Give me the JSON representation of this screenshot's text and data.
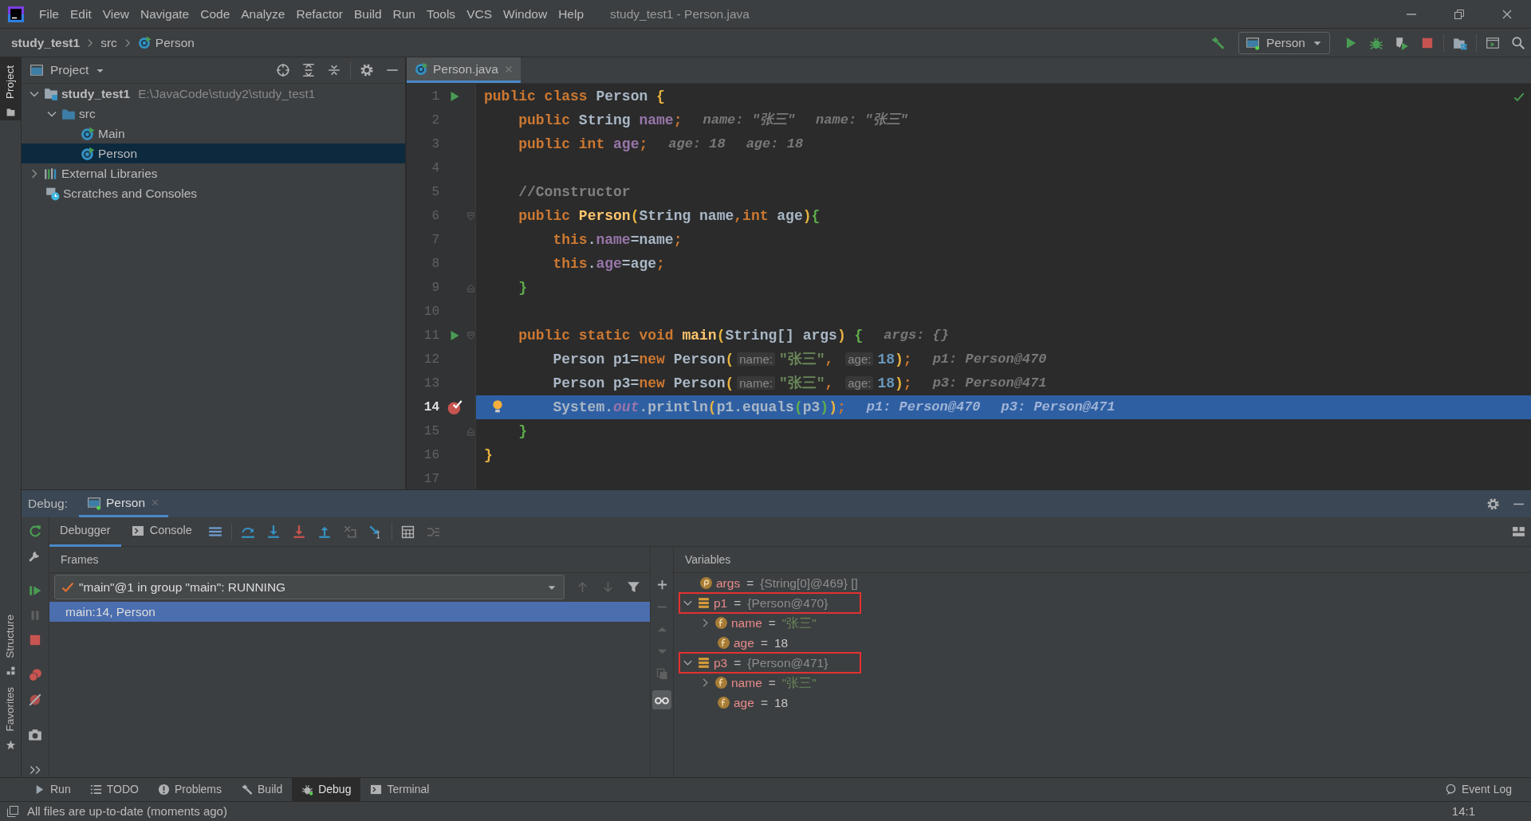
{
  "window": {
    "title": "study_test1 - Person.java"
  },
  "menu": [
    "File",
    "Edit",
    "View",
    "Navigate",
    "Code",
    "Analyze",
    "Refactor",
    "Build",
    "Run",
    "Tools",
    "VCS",
    "Window",
    "Help"
  ],
  "breadcrumbs": [
    {
      "label": "study_test1",
      "kind": "project"
    },
    {
      "label": "src",
      "kind": "folder"
    },
    {
      "label": "Person",
      "kind": "class"
    }
  ],
  "run_config": {
    "label": "Person"
  },
  "tool_stripe": [
    {
      "label": "Project",
      "kind": "project",
      "selected": true
    },
    {
      "label": "Structure",
      "kind": "structure",
      "selected": false
    },
    {
      "label": "Favorites",
      "kind": "favorites",
      "selected": false
    }
  ],
  "project": {
    "title": "Project",
    "tree": [
      {
        "label": "study_test1",
        "path": "E:\\JavaCode\\study2\\study_test1",
        "kind": "module",
        "expanded": true,
        "selected": false,
        "children": [
          {
            "label": "src",
            "kind": "folder",
            "expanded": true,
            "selected": false,
            "children": [
              {
                "label": "Main",
                "kind": "class",
                "selected": false
              },
              {
                "label": "Person",
                "kind": "class",
                "selected": true
              }
            ]
          }
        ]
      },
      {
        "label": "External Libraries",
        "kind": "libraries",
        "expanded": false,
        "selected": false
      },
      {
        "label": "Scratches and Consoles",
        "kind": "scratches",
        "selected": false
      }
    ]
  },
  "editor": {
    "tabs": [
      {
        "label": "Person.java",
        "selected": true
      }
    ],
    "lines": [
      {
        "number": "1",
        "run": true,
        "breakpoint": false,
        "fold_open": false,
        "fold_close": false,
        "bulb": false,
        "current": false,
        "tokens": [
          {
            "kind": "kw",
            "text": "public class "
          },
          {
            "kind": "txt",
            "text": "Person "
          },
          {
            "kind": "b1",
            "text": "{"
          }
        ]
      },
      {
        "number": "2",
        "run": false,
        "breakpoint": false,
        "fold_open": false,
        "fold_close": false,
        "bulb": false,
        "current": false,
        "tokens": [
          {
            "kind": "kw",
            "text": "    public "
          },
          {
            "kind": "txt",
            "text": "String "
          },
          {
            "kind": "fld",
            "text": "name"
          },
          {
            "kind": "kw",
            "text": ";"
          }
        ],
        "values": [
          "name: \"张三\"",
          "name: \"张三\""
        ]
      },
      {
        "number": "3",
        "run": false,
        "breakpoint": false,
        "fold_open": false,
        "fold_close": false,
        "bulb": false,
        "current": false,
        "tokens": [
          {
            "kind": "kw",
            "text": "    public int "
          },
          {
            "kind": "fld",
            "text": "age"
          },
          {
            "kind": "kw",
            "text": ";"
          }
        ],
        "values": [
          "age: 18",
          "age: 18"
        ]
      },
      {
        "number": "4",
        "run": false,
        "breakpoint": false,
        "fold_open": false,
        "fold_close": false,
        "bulb": false,
        "current": false
      },
      {
        "number": "5",
        "run": false,
        "breakpoint": false,
        "fold_open": false,
        "fold_close": false,
        "bulb": false,
        "current": false,
        "tokens": [
          {
            "kind": "cmt",
            "text": "    //Constructor"
          }
        ]
      },
      {
        "number": "6",
        "run": false,
        "breakpoint": false,
        "fold_open": true,
        "fold_close": false,
        "bulb": false,
        "current": false,
        "tokens": [
          {
            "kind": "kw",
            "text": "    public "
          },
          {
            "kind": "mth",
            "text": "Person"
          },
          {
            "kind": "b1",
            "text": "("
          },
          {
            "kind": "txt",
            "text": "String name"
          },
          {
            "kind": "kw",
            "text": ","
          },
          {
            "kind": "kw",
            "text": "int "
          },
          {
            "kind": "txt",
            "text": "age"
          },
          {
            "kind": "b1",
            "text": ")"
          },
          {
            "kind": "b2",
            "text": "{"
          }
        ]
      },
      {
        "number": "7",
        "run": false,
        "breakpoint": false,
        "fold_open": false,
        "fold_close": false,
        "bulb": false,
        "current": false,
        "tokens": [
          {
            "kind": "kw",
            "text": "        this"
          },
          {
            "kind": "txt",
            "text": "."
          },
          {
            "kind": "fld",
            "text": "name"
          },
          {
            "kind": "txt",
            "text": "=name"
          },
          {
            "kind": "kw",
            "text": ";"
          }
        ]
      },
      {
        "number": "8",
        "run": false,
        "breakpoint": false,
        "fold_open": false,
        "fold_close": false,
        "bulb": false,
        "current": false,
        "tokens": [
          {
            "kind": "kw",
            "text": "        this"
          },
          {
            "kind": "txt",
            "text": "."
          },
          {
            "kind": "fld",
            "text": "age"
          },
          {
            "kind": "txt",
            "text": "=age"
          },
          {
            "kind": "kw",
            "text": ";"
          }
        ]
      },
      {
        "number": "9",
        "run": false,
        "breakpoint": false,
        "fold_open": false,
        "fold_close": true,
        "bulb": false,
        "current": false,
        "tokens": [
          {
            "kind": "b2",
            "text": "    }"
          }
        ]
      },
      {
        "number": "10",
        "run": false,
        "breakpoint": false,
        "fold_open": false,
        "fold_close": false,
        "bulb": false,
        "current": false
      },
      {
        "number": "11",
        "run": true,
        "breakpoint": false,
        "fold_open": true,
        "fold_close": false,
        "bulb": false,
        "current": false,
        "tokens": [
          {
            "kind": "kw",
            "text": "    public static void "
          },
          {
            "kind": "mth",
            "text": "main"
          },
          {
            "kind": "b1",
            "text": "("
          },
          {
            "kind": "txt",
            "text": "String[] args"
          },
          {
            "kind": "b1",
            "text": ")"
          },
          {
            "kind": "b2",
            "text": " {"
          }
        ],
        "values": [
          "args: {}"
        ]
      },
      {
        "number": "12",
        "run": false,
        "breakpoint": false,
        "fold_open": false,
        "fold_close": false,
        "bulb": false,
        "current": false,
        "tokens": [
          {
            "kind": "txt",
            "text": "        Person p1="
          },
          {
            "kind": "kw",
            "text": "new "
          },
          {
            "kind": "txt",
            "text": "Person"
          },
          {
            "kind": "b1",
            "text": "("
          },
          {
            "kind": "hint",
            "text": "name:"
          },
          {
            "kind": "str",
            "text": "\"张三\""
          },
          {
            "kind": "kw",
            "text": ", "
          },
          {
            "kind": "hint",
            "text": "age:"
          },
          {
            "kind": "num",
            "text": "18"
          },
          {
            "kind": "b1",
            "text": ")"
          },
          {
            "kind": "kw",
            "text": ";"
          }
        ],
        "values": [
          "p1: Person@470"
        ]
      },
      {
        "number": "13",
        "run": false,
        "breakpoint": false,
        "fold_open": false,
        "fold_close": false,
        "bulb": false,
        "current": false,
        "tokens": [
          {
            "kind": "txt",
            "text": "        Person p3="
          },
          {
            "kind": "kw",
            "text": "new "
          },
          {
            "kind": "txt",
            "text": "Person"
          },
          {
            "kind": "b1",
            "text": "("
          },
          {
            "kind": "hint",
            "text": "name:"
          },
          {
            "kind": "str",
            "text": "\"张三\""
          },
          {
            "kind": "kw",
            "text": ", "
          },
          {
            "kind": "hint",
            "text": "age:"
          },
          {
            "kind": "num",
            "text": "18"
          },
          {
            "kind": "b1",
            "text": ")"
          },
          {
            "kind": "kw",
            "text": ";"
          }
        ],
        "values": [
          "p3: Person@471"
        ]
      },
      {
        "number": "14",
        "run": false,
        "breakpoint": true,
        "fold_open": false,
        "fold_close": false,
        "bulb": true,
        "current": true,
        "tokens": [
          {
            "kind": "txt",
            "text": "        System."
          },
          {
            "kind": "sta",
            "text": "out"
          },
          {
            "kind": "txt",
            "text": ".println"
          },
          {
            "kind": "b1",
            "text": "("
          },
          {
            "kind": "txt",
            "text": "p1.equals"
          },
          {
            "kind": "b2",
            "text": "("
          },
          {
            "kind": "txt",
            "text": "p3"
          },
          {
            "kind": "b2",
            "text": ")"
          },
          {
            "kind": "b1",
            "text": ")"
          },
          {
            "kind": "kw",
            "text": ";"
          }
        ],
        "values": [
          "p1: Person@470",
          "p3: Person@471"
        ]
      },
      {
        "number": "15",
        "run": false,
        "breakpoint": false,
        "fold_open": false,
        "fold_close": true,
        "bulb": false,
        "current": false,
        "tokens": [
          {
            "kind": "b2",
            "text": "    }"
          }
        ]
      },
      {
        "number": "16",
        "run": false,
        "breakpoint": false,
        "fold_open": false,
        "fold_close": false,
        "bulb": false,
        "current": false,
        "tokens": [
          {
            "kind": "b1",
            "text": "}"
          }
        ]
      },
      {
        "number": "17",
        "run": false,
        "breakpoint": false,
        "fold_open": false,
        "fold_close": false,
        "bulb": false,
        "current": false
      }
    ]
  },
  "debug": {
    "label": "Debug:",
    "tabs": [
      {
        "label": "Person",
        "selected": true
      }
    ],
    "subtabs": [
      {
        "label": "Debugger",
        "kind": "debugger",
        "selected": true
      },
      {
        "label": "Console",
        "kind": "console",
        "selected": false
      }
    ],
    "frames": {
      "title": "Frames",
      "thread": "\"main\"@1 in group \"main\": RUNNING",
      "items": [
        {
          "label": "main:14, Person",
          "selected": true
        }
      ]
    },
    "variables": {
      "title": "Variables",
      "items": [
        {
          "kind": "param",
          "name": "args",
          "operator": "=",
          "value": "{String[0]@469} []",
          "color": "#8c8c8c",
          "boxed": false
        },
        {
          "kind": "object",
          "name": "p1",
          "operator": "=",
          "value": "{Person@470}",
          "color": "#8c8c8c",
          "expanded": true,
          "boxed": true,
          "children": [
            {
              "kind": "field",
              "name": "name",
              "operator": "=",
              "value": "\"张三\"",
              "color": "#6a8759",
              "expanded": false,
              "boxed": false
            },
            {
              "kind": "field",
              "name": "age",
              "operator": "=",
              "value": "18",
              "color": "#c8c8c8",
              "boxed": false
            }
          ]
        },
        {
          "kind": "object",
          "name": "p3",
          "operator": "=",
          "value": "{Person@471}",
          "color": "#8c8c8c",
          "expanded": true,
          "boxed": true,
          "children": [
            {
              "kind": "field",
              "name": "name",
              "operator": "=",
              "value": "\"张三\"",
              "color": "#6a8759",
              "expanded": false,
              "boxed": false
            },
            {
              "kind": "field",
              "name": "age",
              "operator": "=",
              "value": "18",
              "color": "#c8c8c8",
              "boxed": false
            }
          ]
        }
      ]
    }
  },
  "tool_windows": [
    {
      "label": "Run",
      "kind": "run",
      "selected": false
    },
    {
      "label": "TODO",
      "kind": "todo",
      "selected": false
    },
    {
      "label": "Problems",
      "kind": "problems",
      "selected": false
    },
    {
      "label": "Build",
      "kind": "build",
      "selected": false
    },
    {
      "label": "Debug",
      "kind": "debug",
      "selected": true
    },
    {
      "label": "Terminal",
      "kind": "terminal",
      "selected": false
    }
  ],
  "event_log": "Event Log",
  "status": {
    "message": "All files are up-to-date (moments ago)",
    "position": "14:1"
  }
}
